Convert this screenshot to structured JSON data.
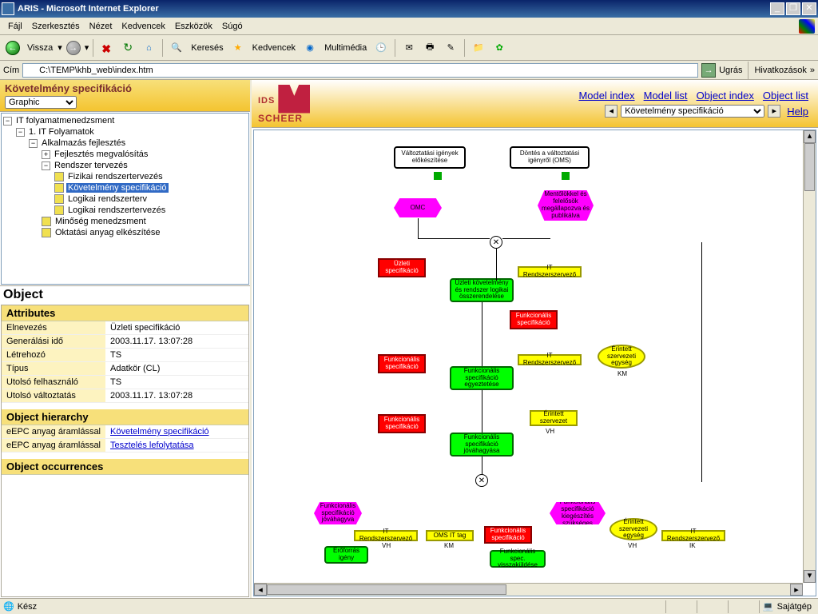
{
  "window": {
    "title": "ARIS - Microsoft Internet Explorer"
  },
  "menu": {
    "items": [
      "Fájl",
      "Szerkesztés",
      "Nézet",
      "Kedvencek",
      "Eszközök",
      "Súgó"
    ]
  },
  "toolbar": {
    "back": "Vissza",
    "search": "Keresés",
    "favorites": "Kedvencek",
    "media": "Multimédia"
  },
  "address": {
    "label": "Cím",
    "value": "C:\\TEMP\\khb_web\\index.htm",
    "go": "Ugrás",
    "links": "Hivatkozások"
  },
  "left": {
    "title": "Követelmény specifikáció",
    "view_select": "Graphic",
    "tree": {
      "root": "IT folyamatmenedzsment",
      "n1": "1. IT Folyamatok",
      "n2": "Alkalmazás fejlesztés",
      "n3": "Fejlesztés megvalósítás",
      "n4": "Rendszer tervezés",
      "l1": "Fizikai rendszertervezés",
      "l2": "Követelmény specifikáció",
      "l3": "Logikai rendszerterv",
      "l4": "Logikai rendszertervezés",
      "l5": "Minőség menedzsment",
      "l6": "Oktatási anyag elkészítése"
    }
  },
  "object": {
    "title": "Object",
    "sect_attr": "Attributes",
    "attrs": [
      {
        "k": "Elnevezés",
        "v": "Üzleti specifikáció"
      },
      {
        "k": "Generálási idő",
        "v": "2003.11.17. 13:07:28"
      },
      {
        "k": "Létrehozó",
        "v": "TS"
      },
      {
        "k": "Típus",
        "v": "Adatkör (CL)"
      },
      {
        "k": "Utolsó felhasználó",
        "v": "TS"
      },
      {
        "k": "Utolsó változtatás",
        "v": "2003.11.17. 13:07:28"
      }
    ],
    "sect_hier": "Object hierarchy",
    "hier": [
      {
        "k": "eEPC anyag áramlással",
        "v": "Követelmény specifikáció"
      },
      {
        "k": "eEPC anyag áramlással",
        "v": "Tesztelés lefolytatása"
      }
    ],
    "sect_occ": "Object occurrences"
  },
  "right": {
    "logo1": "IDS",
    "logo2": "SCHEER",
    "links": [
      "Model index",
      "Model list",
      "Object index",
      "Object list"
    ],
    "nav_select": "Követelmény specifikáció",
    "help": "Help"
  },
  "diagram": {
    "n_top1": "Változtatási igények előkészítése",
    "n_top2": "Döntés a változtatási igényről (OMS)",
    "n_omc": "OMC",
    "n_r1": "Üzleti specifikáció",
    "n_y1": "IT Rendszerszervező",
    "n_g1": "Üzleti követelmény és rendszer logikai összerendelése",
    "n_r2": "Funkcionális specifikáció",
    "n_r3": "Funkcionális specifikáció",
    "n_y2": "IT Rendszerszervező",
    "n_g2": "Funkcionális specifikáció egyeztetése",
    "n_o1": "Érintett szervezeti egység",
    "n_r4": "Funkcionális specifikáció",
    "n_y3": "Érintett szervezet",
    "n_g3": "Funkcionális specifikáció jóváhagyása",
    "n_m1": "Funkcionális specifikáció jóváhagyva",
    "n_y4": "IT Rendszerszervező",
    "n_y5": "OMS IT tag",
    "n_r5": "Funkcionális specifikáció",
    "n_g4": "Erőforrás igény",
    "n_m2": "Funkcionális specifikáció kiegészítés szükséges",
    "n_o2": "Érintett szervezeti egység",
    "n_y6": "IT Rendszerszervező",
    "n_g5": "Funkcionális spec. visszaküldése",
    "n_mag_right": "Mentőlökkel és felelősök megállapozva és publikálva",
    "lbl_vh": "VH",
    "lbl_km": "KM",
    "lbl_ik": "IK"
  },
  "status": {
    "ready": "Kész",
    "zone": "Sajátgép"
  }
}
